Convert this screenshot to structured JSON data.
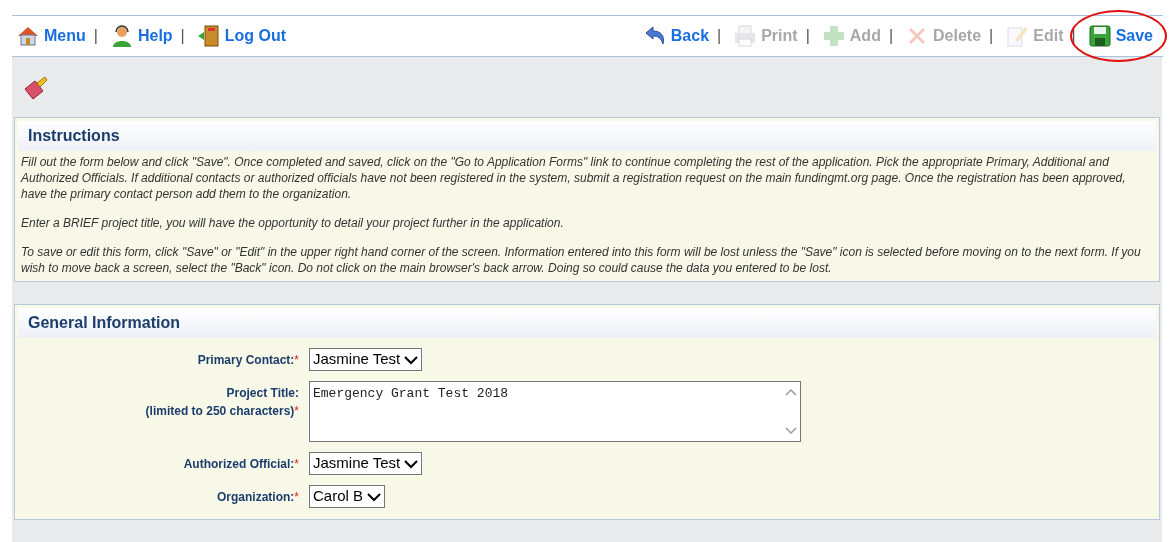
{
  "toolbar_left": [
    {
      "kind": "menu",
      "label": "Menu",
      "disabled": false,
      "separator": "|"
    },
    {
      "kind": "help",
      "label": "Help",
      "disabled": false,
      "separator": "|"
    },
    {
      "kind": "logout",
      "label": "Log Out",
      "disabled": false
    }
  ],
  "toolbar_right": [
    {
      "kind": "back",
      "label": "Back",
      "disabled": false,
      "highlighted": false,
      "separator": "|"
    },
    {
      "kind": "print",
      "label": "Print",
      "disabled": true,
      "highlighted": false,
      "separator": "|"
    },
    {
      "kind": "add",
      "label": "Add",
      "disabled": true,
      "highlighted": false,
      "separator": "|"
    },
    {
      "kind": "delete",
      "label": "Delete",
      "disabled": true,
      "highlighted": false,
      "separator": "|"
    },
    {
      "kind": "edit",
      "label": "Edit",
      "disabled": true,
      "highlighted": false,
      "separator": "|"
    },
    {
      "kind": "save",
      "label": "Save",
      "disabled": false,
      "highlighted": true
    }
  ],
  "instructions": {
    "title": "Instructions",
    "paragraphs": [
      "Fill out the form below and click \"Save\". Once completed and saved, click on the \"Go to Application Forms\" link to continue completing the rest of the application. Pick the appropriate Primary, Additional and Authorized Officials. If additional contacts or authorized officials have not been registered in the system, submit a registration request on the main fundingmt.org page. Once the registration has been approved, have the primary contact person add them to the organization.",
      "Enter a BRIEF project title, you will have the opportunity to detail your project further in the application.",
      "To save or edit this form, click \"Save\" or \"Edit\" in the upper right hand corner of the screen. Information entered into this form will be lost unless the \"Save\" icon is selected before moving on to the next form. If you wish to move back a screen, select the \"Back\" icon. Do not click on the main browser's back arrow. Doing so could cause the data you entered to be lost."
    ]
  },
  "general_information": {
    "title": "General Information",
    "fields": [
      {
        "kind": "select",
        "label": "Primary Contact:",
        "mark": "*",
        "value": "Jasmine Test"
      },
      {
        "kind": "textarea",
        "label": "Project Title:",
        "note": "(limited to 250 characters)",
        "mark": "*",
        "value": "Emergency Grant Test 2018"
      },
      {
        "kind": "select",
        "label": "Authorized Official:",
        "mark": "*",
        "value": "Jasmine Test"
      },
      {
        "kind": "select",
        "label": "Organization:",
        "mark": "*",
        "value": "Carol B"
      }
    ]
  }
}
